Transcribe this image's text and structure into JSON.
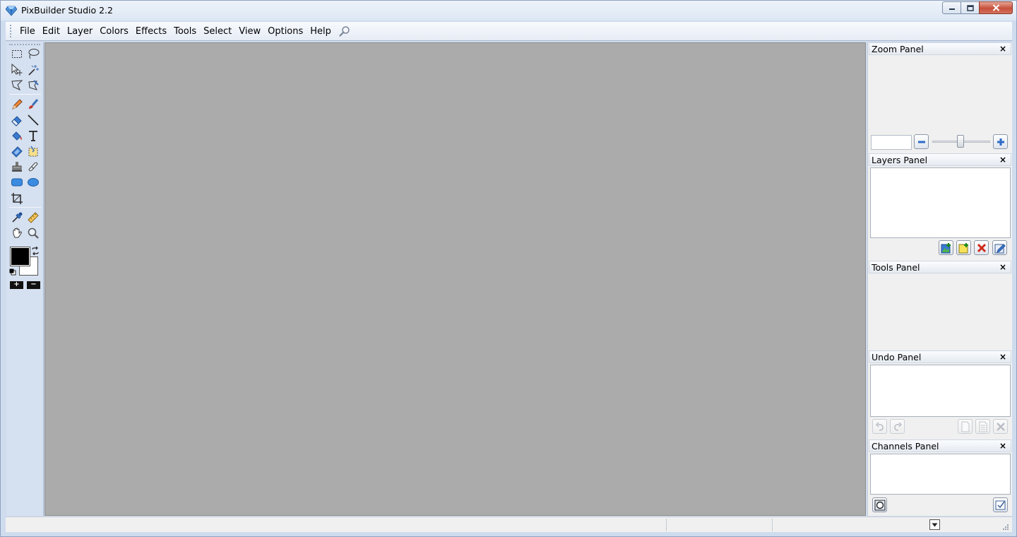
{
  "window": {
    "title": "PixBuilder Studio 2.2"
  },
  "menu": {
    "items": [
      "File",
      "Edit",
      "Layer",
      "Colors",
      "Effects",
      "Tools",
      "Select",
      "View",
      "Options",
      "Help"
    ]
  },
  "toolbox": {
    "tools": [
      "rectangle-select-icon",
      "lasso-select-icon",
      "move-icon",
      "magic-wand-icon",
      "polygon-lasso-icon",
      "magnetic-lasso-icon",
      "pencil-icon",
      "brush-icon",
      "eraser-icon",
      "line-icon",
      "paint-bucket-icon",
      "text-icon",
      "gradient-icon",
      "fill-selection-icon",
      "clone-stamp-icon",
      "healing-icon",
      "rounded-rectangle-icon",
      "ellipse-icon",
      "crop-icon",
      "eyedropper-icon",
      "ruler-icon",
      "hand-icon",
      "zoom-icon"
    ],
    "foreground_color": "#000000",
    "background_color": "#ffffff",
    "plus_label": "+",
    "minus_label": "−"
  },
  "panels": {
    "zoom": {
      "title": "Zoom Panel",
      "input_value": ""
    },
    "layers": {
      "title": "Layers Panel"
    },
    "tools": {
      "title": "Tools Panel"
    },
    "undo": {
      "title": "Undo Panel"
    },
    "channels": {
      "title": "Channels Panel"
    },
    "close_label": "×"
  },
  "colors": {
    "canvas": "#ababab",
    "chrome": "#d5e0f0",
    "panel": "#f0f0f0"
  }
}
